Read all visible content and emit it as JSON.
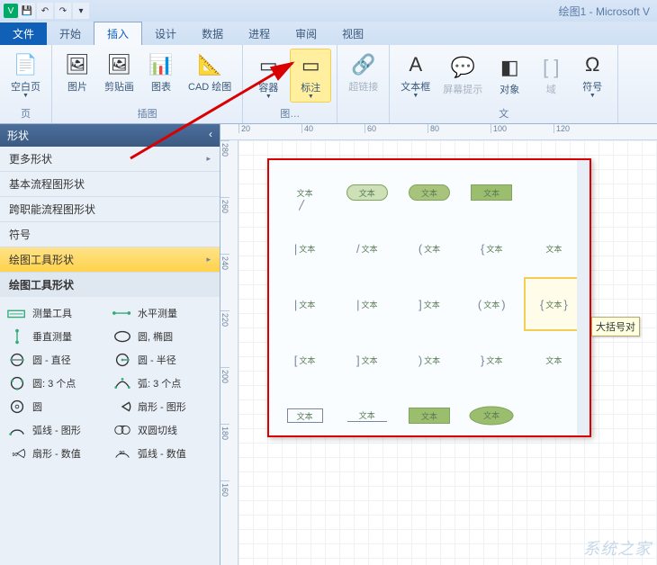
{
  "titlebar": {
    "app_icon_letter": "V",
    "doc_title": "绘图1 - Microsoft V"
  },
  "tabs": {
    "file": "文件",
    "items": [
      "开始",
      "插入",
      "设计",
      "数据",
      "进程",
      "审阅",
      "视图"
    ],
    "active_index": 1
  },
  "ribbon": {
    "groups": [
      {
        "title": "页",
        "buttons": [
          {
            "name": "blank-page-button",
            "label": "空白页",
            "icon": "📄",
            "dropdown": true
          }
        ]
      },
      {
        "title": "插图",
        "buttons": [
          {
            "name": "picture-button",
            "label": "图片",
            "icon": "🖼"
          },
          {
            "name": "clipart-button",
            "label": "剪贴画",
            "icon": "🖼"
          },
          {
            "name": "chart-button",
            "label": "图表",
            "icon": "📊"
          },
          {
            "name": "cad-button",
            "label": "CAD 绘图",
            "icon": "📐"
          }
        ]
      },
      {
        "title": "图…",
        "buttons": [
          {
            "name": "container-button",
            "label": "容器",
            "icon": "▭",
            "dropdown": true
          },
          {
            "name": "callout-button",
            "label": "标注",
            "icon": "▭",
            "dropdown": true,
            "highlight": true
          }
        ]
      },
      {
        "title": "",
        "buttons": [
          {
            "name": "hyperlink-button",
            "label": "超链接",
            "icon": "🔗",
            "disabled": true
          }
        ]
      },
      {
        "title": "文",
        "buttons": [
          {
            "name": "textbox-button",
            "label": "文本框",
            "icon": "A",
            "dropdown": true
          },
          {
            "name": "screentip-button",
            "label": "屏幕提示",
            "icon": "💬",
            "disabled": true
          },
          {
            "name": "object-button",
            "label": "对象",
            "icon": "◧"
          },
          {
            "name": "field-button",
            "label": "域",
            "icon": "[ ]",
            "disabled": true
          },
          {
            "name": "symbol-button",
            "label": "符号",
            "icon": "Ω",
            "dropdown": true
          }
        ]
      }
    ]
  },
  "shapes_pane": {
    "header": "形状",
    "items": [
      {
        "label": "更多形状",
        "chevron": true
      },
      {
        "label": "基本流程图形状"
      },
      {
        "label": "跨职能流程图形状"
      },
      {
        "label": "符号"
      },
      {
        "label": "绘图工具形状",
        "active": true,
        "chevron": true
      }
    ],
    "sub_header": "绘图工具形状",
    "shapes": [
      {
        "label": "测量工具"
      },
      {
        "label": "水平测量"
      },
      {
        "label": "垂直测量"
      },
      {
        "label": "圆, 椭圆"
      },
      {
        "label": "圆 - 直径"
      },
      {
        "label": "圆 - 半径"
      },
      {
        "label": "圆: 3 个点"
      },
      {
        "label": "弧: 3 个点"
      },
      {
        "label": "圆"
      },
      {
        "label": "扇形 - 图形"
      },
      {
        "label": "弧线 - 图形"
      },
      {
        "label": "双圆切线"
      },
      {
        "label": "扇形 - 数值"
      },
      {
        "label": "弧线 - 数值"
      }
    ]
  },
  "ruler_h": [
    "20",
    "40",
    "60",
    "80",
    "100",
    "120"
  ],
  "ruler_v": [
    "280",
    "260",
    "240",
    "220",
    "200",
    "180",
    "160"
  ],
  "gallery": {
    "item_label": "文本",
    "tooltip": "大括号对",
    "selected_row": 2,
    "selected_col": 4
  },
  "watermark": "系统之家"
}
